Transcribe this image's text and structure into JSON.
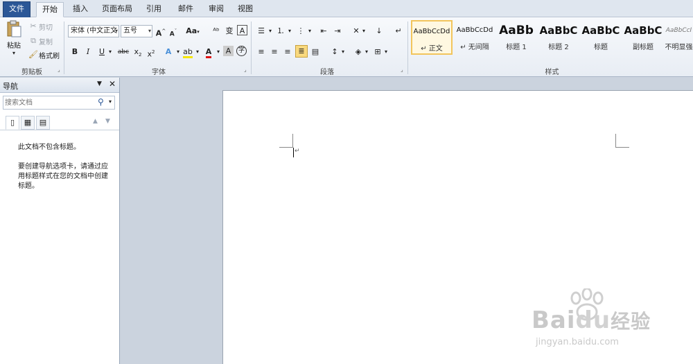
{
  "ribbon_tabs": [
    {
      "label": "文件"
    },
    {
      "label": "开始"
    },
    {
      "label": "插入"
    },
    {
      "label": "页面布局"
    },
    {
      "label": "引用"
    },
    {
      "label": "邮件"
    },
    {
      "label": "审阅"
    },
    {
      "label": "视图"
    }
  ],
  "clipboard": {
    "paste": "粘贴",
    "cut": "剪切",
    "copy": "复制",
    "format_painter": "格式刷",
    "group_label": "剪贴板"
  },
  "font": {
    "font_name": "宋体 (中文正文",
    "font_size": "五号",
    "group_label": "字体"
  },
  "paragraph": {
    "group_label": "段落"
  },
  "styles": {
    "group_label": "样式",
    "items": [
      {
        "sample": "AaBbCcDd",
        "name": "↵ 正文"
      },
      {
        "sample": "AaBbCcDd",
        "name": "↵ 无间隔"
      },
      {
        "sample": "AaBb",
        "name": "标题 1"
      },
      {
        "sample": "AaBbC",
        "name": "标题 2"
      },
      {
        "sample": "AaBbC",
        "name": "标题"
      },
      {
        "sample": "AaBbC",
        "name": "副标题"
      },
      {
        "sample": "AaBbCcI",
        "name": "不明显强"
      }
    ]
  },
  "nav_pane": {
    "title": "导航",
    "search_placeholder": "搜索文档",
    "msg1": "此文档不包含标题。",
    "msg2": "要创建导航选项卡，请通过应用标题样式在您的文档中创建标题。"
  },
  "watermark": {
    "url": "jingyan.baidu.com"
  },
  "colors": {
    "file_tab": "#2b5797",
    "highlight": "#f9d97e",
    "font_color": "#d11"
  }
}
